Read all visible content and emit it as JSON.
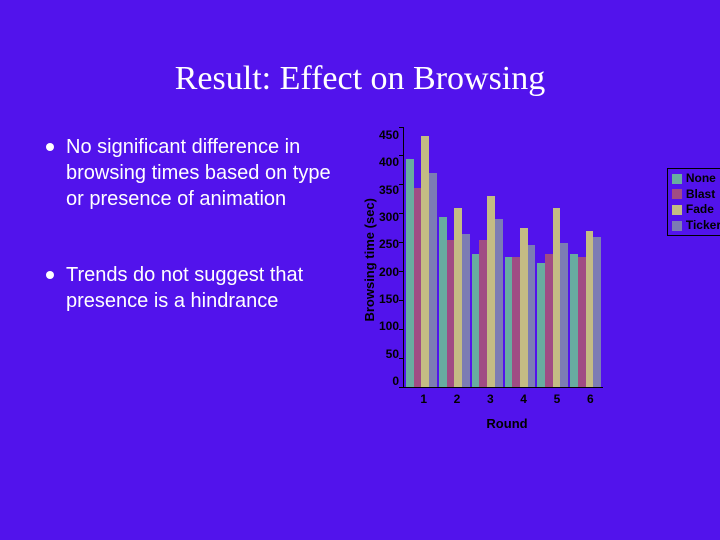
{
  "title": "Result: Effect on Browsing",
  "bullets": [
    "No significant difference in browsing times based on type or presence of animation",
    "Trends do not suggest that presence is a hindrance"
  ],
  "chart_data": {
    "type": "bar",
    "categories": [
      "1",
      "2",
      "3",
      "4",
      "5",
      "6"
    ],
    "series": [
      {
        "name": "None",
        "color": "#68aca0",
        "values": [
          395,
          295,
          230,
          225,
          215,
          230
        ]
      },
      {
        "name": "Blast",
        "color": "#a04c84",
        "values": [
          345,
          255,
          255,
          225,
          230,
          225
        ]
      },
      {
        "name": "Fade",
        "color": "#c4bc84",
        "values": [
          435,
          310,
          330,
          275,
          310,
          270
        ]
      },
      {
        "name": "Ticker",
        "color": "#7c7cb4",
        "values": [
          370,
          265,
          290,
          245,
          250,
          260
        ]
      }
    ],
    "ylabel": "Browsing time (sec)",
    "xlabel": "Round",
    "ylim": [
      0,
      450
    ],
    "yticks": [
      0,
      50,
      100,
      150,
      200,
      250,
      300,
      350,
      400,
      450
    ]
  }
}
